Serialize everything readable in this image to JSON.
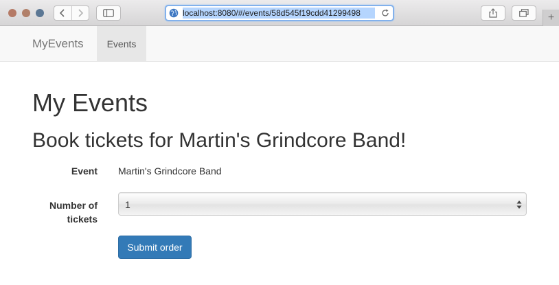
{
  "browser": {
    "url": "localhost:8080/#/events/58d545f19cdd41299498",
    "new_tab_label": "+"
  },
  "navbar": {
    "brand": "MyEvents",
    "items": [
      {
        "label": "Events",
        "active": true
      }
    ]
  },
  "page": {
    "title": "My Events",
    "form_title": "Book tickets for Martin's Grindcore Band!"
  },
  "form": {
    "event_label": "Event",
    "event_value": "Martin's Grindcore Band",
    "tickets_label": "Number of tickets",
    "tickets_value": "1",
    "submit_label": "Submit order"
  },
  "colors": {
    "primary": "#337ab7",
    "navbar_bg": "#f8f8f8",
    "url_highlight": "#b5d5fe"
  },
  "icons": {
    "back": "chevron-left-icon",
    "forward": "chevron-right-icon",
    "sidebar": "sidebar-icon",
    "site": "globe-icon",
    "reload": "reload-icon",
    "share": "share-icon",
    "tabs": "tabs-icon",
    "select": "select-arrows-icon"
  }
}
